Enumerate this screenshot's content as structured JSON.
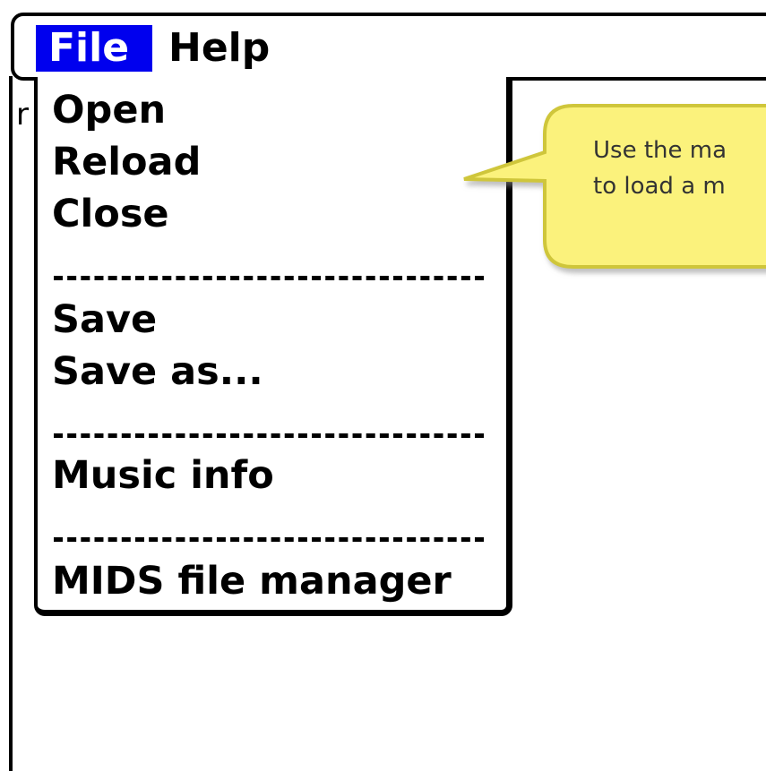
{
  "menubar": {
    "file_label": "File",
    "help_label": "Help"
  },
  "background": {
    "peek_char": "r"
  },
  "file_menu": {
    "items": [
      {
        "label": "Open"
      },
      {
        "label": "Reload"
      },
      {
        "label": "Close"
      },
      {
        "label": "Save"
      },
      {
        "label": "Save as..."
      },
      {
        "label": "Music info"
      },
      {
        "label": "MIDS file manager"
      }
    ]
  },
  "tooltip": {
    "line1": "Use the ma",
    "line2": "to load a m"
  },
  "colors": {
    "menu_highlight": "#0000ee",
    "tooltip_fill": "#fbf27c",
    "tooltip_border": "#cfc63a"
  }
}
